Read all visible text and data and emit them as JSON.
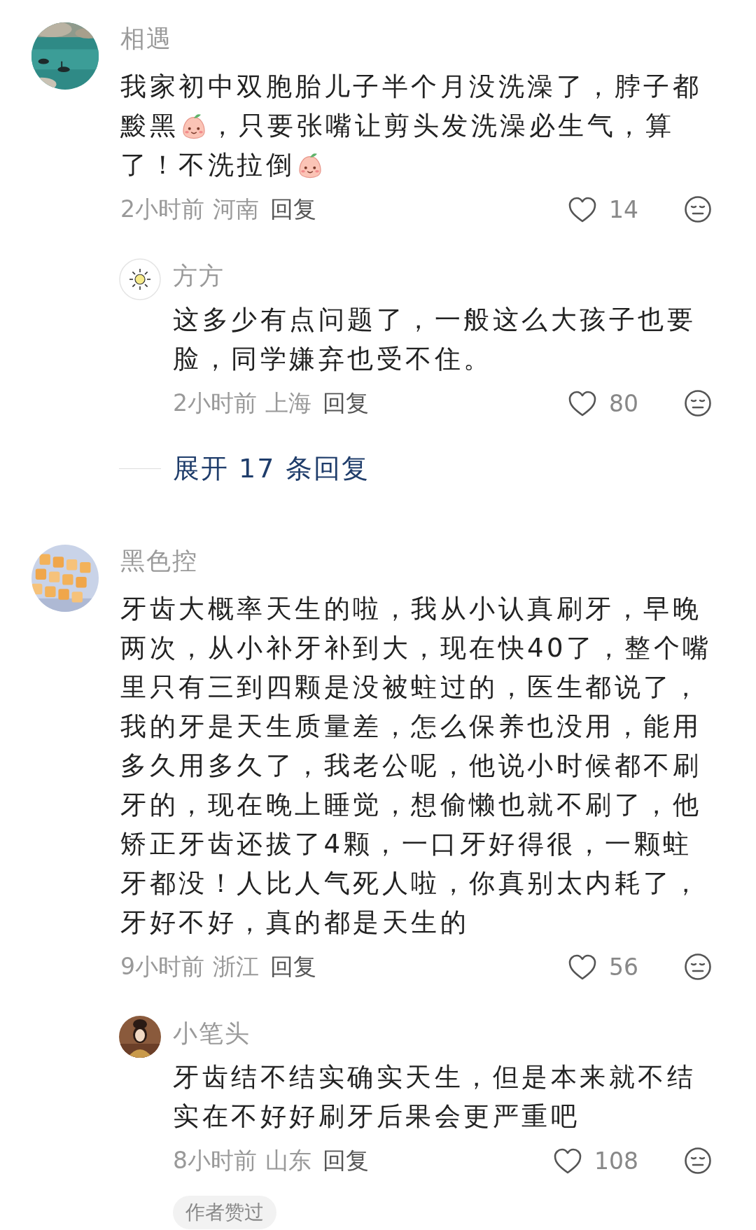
{
  "comments": [
    {
      "author": "相遇",
      "avatar": {
        "kind": "lake"
      },
      "body": [
        {
          "kind": "text",
          "text": "我家初中双胞胎儿子半个月没洗澡了，脖子都"
        },
        {
          "kind": "text",
          "text": "黢黑"
        },
        {
          "kind": "emoji"
        },
        {
          "kind": "text",
          "text": "，只要张嘴让剪头发洗澡必生气，算"
        },
        {
          "kind": "text",
          "text": "了！不洗拉倒"
        },
        {
          "kind": "emoji"
        }
      ],
      "time": "2小时前",
      "location": "河南",
      "reply_label": "回复",
      "likes": "14",
      "replies": [
        {
          "author": "方方",
          "avatar": {
            "kind": "sun"
          },
          "body": [
            {
              "kind": "text",
              "text": "这多少有点问题了，一般这么大孩子也要脸，同学嫌弃也受不住。"
            }
          ],
          "time": "2小时前",
          "location": "上海",
          "reply_label": "回复",
          "likes": "80"
        }
      ],
      "expand_label": "展开 17 条回复"
    },
    {
      "author": "黑色控",
      "avatar": {
        "kind": "tiles"
      },
      "body": [
        {
          "kind": "text",
          "text": "牙齿大概率天生的啦，我从小认真刷牙，早晚两次，从小补牙补到大，现在快40了，整个嘴里只有三到四颗是没被蛀过的，医生都说了，我的牙是天生质量差，怎么保养也没用，能用多久用多久了，我老公呢，他说小时候都不刷牙的，现在晚上睡觉，想偷懒也就不刷了，他矫正牙齿还拔了4颗，一口牙好得很，一颗蛀牙都没！人比人气死人啦，你真别太内耗了，牙好不好，真的都是天生的"
        }
      ],
      "time": "9小时前",
      "location": "浙江",
      "reply_label": "回复",
      "likes": "56",
      "replies": [
        {
          "author": "小笔头",
          "avatar": {
            "kind": "portrait"
          },
          "body": [
            {
              "kind": "text",
              "text": "牙齿结不结实确实天生，但是本来就不结实在不好好刷牙后果会更严重吧"
            }
          ],
          "time": "8小时前",
          "location": "山东",
          "reply_label": "回复",
          "likes": "108",
          "badge": "作者赞过"
        }
      ]
    }
  ]
}
